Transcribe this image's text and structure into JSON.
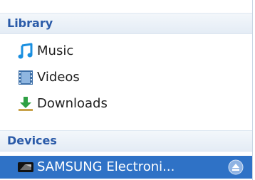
{
  "sidebar": {
    "library": {
      "header": "Library",
      "items": [
        {
          "label": "Music",
          "icon": "music-note-icon"
        },
        {
          "label": "Videos",
          "icon": "film-icon"
        },
        {
          "label": "Downloads",
          "icon": "download-icon"
        }
      ]
    },
    "devices": {
      "header": "Devices",
      "items": [
        {
          "label": "SAMSUNG Electroni...",
          "icon": "phone-icon",
          "action_icon": "eject-icon",
          "selected": true
        }
      ]
    }
  },
  "colors": {
    "header_text": "#2a5aa8",
    "selection": "#2f72c6"
  }
}
